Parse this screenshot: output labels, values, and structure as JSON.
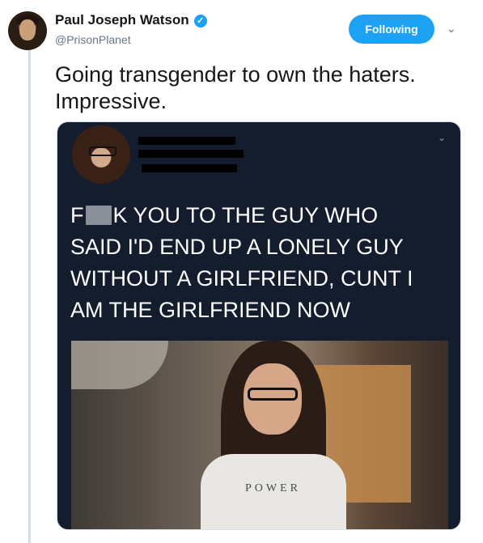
{
  "author": {
    "name": "Paul Joseph Watson",
    "handle": "@PrisonPlanet",
    "verified_icon": "✓"
  },
  "follow_button": {
    "label": "Following"
  },
  "menu": {
    "caret": "⌄"
  },
  "tweet": {
    "text_line1": "Going transgender to own the haters.",
    "text_line2": "Impressive."
  },
  "media": {
    "meme_line1_start": "F",
    "meme_line1_end": "K YOU TO THE GUY WHO",
    "meme_line2": "SAID I'D END UP A LONELY GUY",
    "meme_line3": "WITHOUT A GIRLFRIEND, CUNT I",
    "meme_line4": "AM THE GIRLFRIEND NOW",
    "shirt_text": "POWER",
    "inner_caret": "⌄"
  },
  "colors": {
    "accent": "#1da1f2",
    "thread_line": "#c4e1f7",
    "media_bg": "#141d2e"
  }
}
